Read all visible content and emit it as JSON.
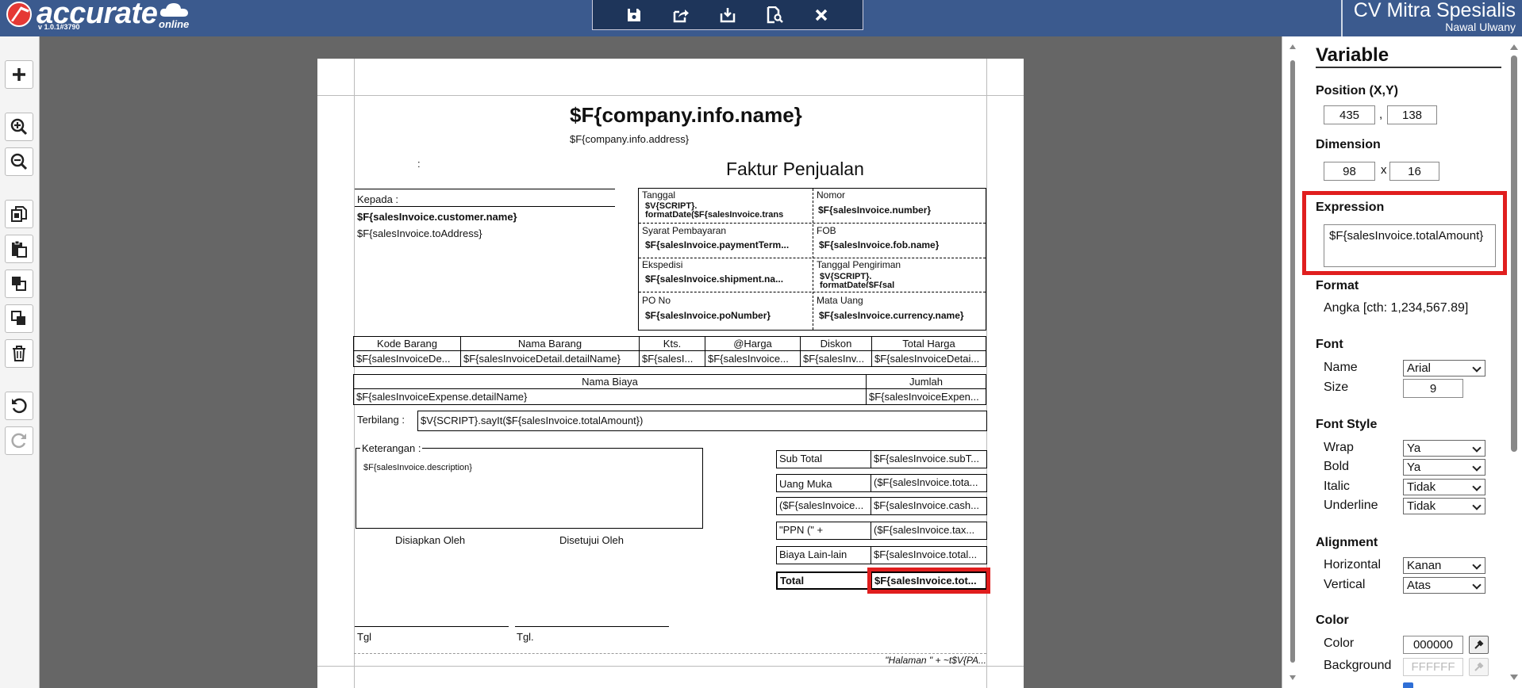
{
  "header": {
    "logo_text": "accurate",
    "logo_sub": "online",
    "version": "v 1.0.1#3790",
    "company_name": "CV Mitra Spesialis",
    "user_name": "Nawal Ulwany",
    "toolbar": [
      "save-icon",
      "export-icon",
      "import-icon",
      "preview-icon",
      "close-icon"
    ]
  },
  "left_toolbar": [
    "add-icon",
    "zoom-in-icon",
    "zoom-out-icon",
    "copy-icon",
    "paste-icon",
    "bring-front-icon",
    "send-back-icon",
    "delete-icon",
    "undo-icon",
    "redo-icon"
  ],
  "report": {
    "company_name": "$F{company.info.name}",
    "company_address": "$F{company.info.address}",
    "colon": ":",
    "title": "Faktur Penjualan",
    "kepada": "Kepada :",
    "customer_name": "$F{salesInvoice.customer.name}",
    "to_address": "$F{salesInvoice.toAddress}",
    "info": {
      "tanggal_label": "Tanggal",
      "tanggal_value": "$V{SCRIPT}.",
      "tanggal_value2": "formatDate($F{salesInvoice.trans",
      "nomor_label": "Nomor",
      "nomor_value": "$F{salesInvoice.number}",
      "syarat_label": "Syarat Pembayaran",
      "syarat_value": "$F{salesInvoice.paymentTerm...",
      "fob_label": "FOB",
      "fob_value": "$F{salesInvoice.fob.name}",
      "ekspedisi_label": "Ekspedisi",
      "ekspedisi_value": "$F{salesInvoice.shipment.na...",
      "tgl_kirim_label": "Tanggal Pengiriman",
      "tgl_kirim_value": "$V{SCRIPT}.",
      "tgl_kirim_value2": "formatDate($F{sal",
      "po_label": "PO No",
      "po_value": "$F{salesInvoice.poNumber}",
      "mata_uang_label": "Mata Uang",
      "mata_uang_value": "$F{salesInvoice.currency.name}"
    },
    "detail_headers": [
      "Kode Barang",
      "Nama Barang",
      "Kts.",
      "@Harga",
      "Diskon",
      "Total Harga"
    ],
    "detail_values": [
      "$F{salesInvoiceDe...",
      "$F{salesInvoiceDetail.detailName}",
      "$F{salesI...",
      "$F{salesInvoice...",
      "$F{salesInv...",
      "$F{salesInvoiceDetai..."
    ],
    "expense_headers": [
      "Nama Biaya",
      "Jumlah"
    ],
    "expense_values": [
      "$F{salesInvoiceExpense.detailName}",
      "$F{salesInvoiceExpen..."
    ],
    "terbilang_label": "Terbilang :",
    "terbilang_value": "$V{SCRIPT}.sayIt($F{salesInvoice.totalAmount})",
    "keterangan_label": "Keterangan :",
    "keterangan_value": "$F{salesInvoice.description}",
    "disiapkan": "Disiapkan Oleh",
    "disetujui": "Disetujui Oleh",
    "tgl1": "Tgl",
    "tgl2": "Tgl.",
    "totals": [
      {
        "label": "Sub Total",
        "value": "$F{salesInvoice.subT..."
      },
      {
        "label": "Uang Muka",
        "value": "($F{salesInvoice.tota..."
      },
      {
        "label": "($F{salesInvoice...",
        "value": "$F{salesInvoice.cash..."
      },
      {
        "label": "\"PPN (\" +",
        "value": "($F{salesInvoice.tax..."
      },
      {
        "label": "Biaya Lain-lain",
        "value": "$F{salesInvoice.total..."
      },
      {
        "label": "Total",
        "value": "$F{salesInvoice.tot..."
      }
    ],
    "footer": "\"Halaman \" + ~t$V{PA..."
  },
  "panel": {
    "title": "Variable",
    "position_label": "Position (X,Y)",
    "pos_x": "435",
    "pos_y": "138",
    "pos_sep": ",",
    "dimension_label": "Dimension",
    "dim_w": "98",
    "dim_h": "16",
    "dim_sep": "x",
    "expression_label": "Expression",
    "expression_value": "$F{salesInvoice.totalAmount}",
    "format_label": "Format",
    "format_value": "Angka [cth: 1,234,567.89]",
    "font_label": "Font",
    "font_name_label": "Name",
    "font_name_value": "Arial",
    "font_size_label": "Size",
    "font_size_value": "9",
    "font_style_label": "Font Style",
    "wrap_label": "Wrap",
    "wrap_value": "Ya",
    "bold_label": "Bold",
    "bold_value": "Ya",
    "italic_label": "Italic",
    "italic_value": "Tidak",
    "underline_label": "Underline",
    "underline_value": "Tidak",
    "alignment_label": "Alignment",
    "horizontal_label": "Horizontal",
    "horizontal_value": "Kanan",
    "vertical_label": "Vertical",
    "vertical_value": "Atas",
    "color_label": "Color",
    "color_field_label": "Color",
    "color_value": "000000",
    "background_label": "Background",
    "background_value": "FFFFFF"
  },
  "colors": {
    "header": "#3b5a8e",
    "toolbar": "#1e355a",
    "highlight": "#e01e1e",
    "logo_mark": "#e53935"
  }
}
